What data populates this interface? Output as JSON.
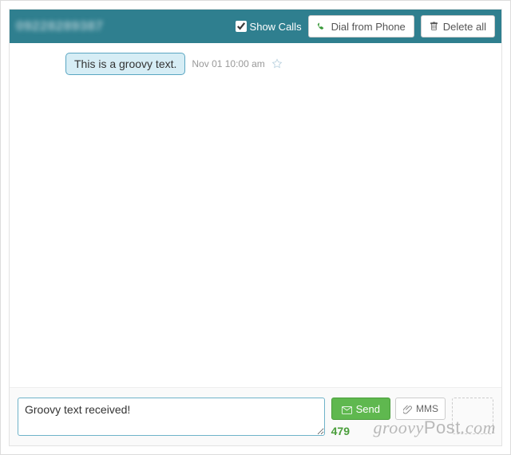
{
  "header": {
    "phone_number": "09228289387",
    "show_calls_label": "Show Calls",
    "show_calls_checked": true,
    "dial_label": "Dial from Phone",
    "delete_label": "Delete all"
  },
  "conversation": {
    "messages": [
      {
        "text": "This is a groovy text.",
        "timestamp": "Nov 01 10:00 am"
      }
    ]
  },
  "composer": {
    "input_value": "Groovy text received!",
    "send_label": "Send",
    "mms_label": "MMS",
    "char_count": "479"
  },
  "watermark": "groovyPost.com"
}
